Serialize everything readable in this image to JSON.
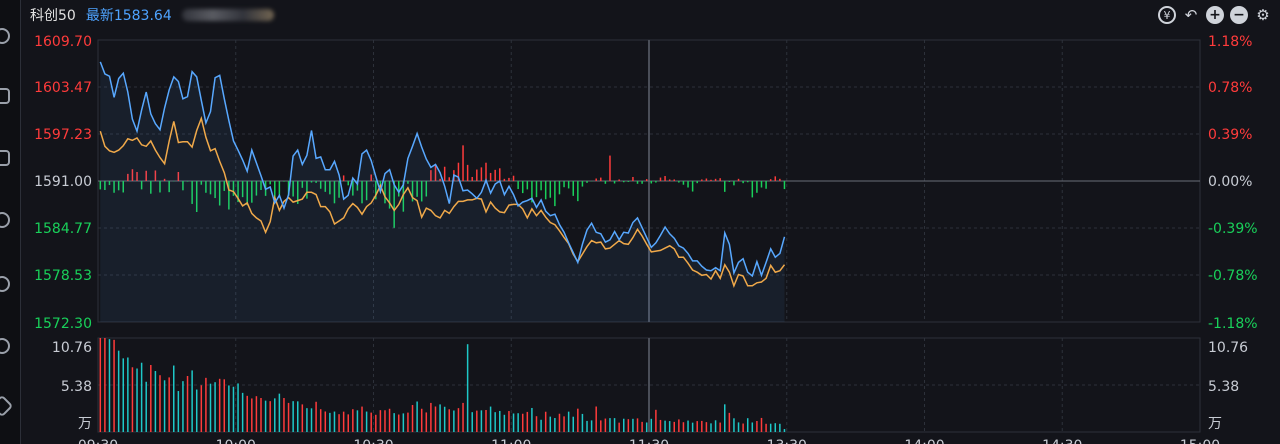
{
  "header": {
    "title": "科创50",
    "latest_label": "最新1583.64",
    "tools": [
      "reset-icon",
      "undo-icon",
      "zoom-in-icon",
      "zoom-out-icon",
      "settings-icon"
    ]
  },
  "colors": {
    "up": "#ff3b3b",
    "down": "#19d05a",
    "flat": "#c8ccd4",
    "price": "#58a8ff",
    "avg": "#f0a94a",
    "grid": "#2d313a"
  },
  "chart_data": {
    "type": "line",
    "price_axis": {
      "ylim": [
        1572.3,
        1609.7
      ],
      "ticks": [
        "1609.70",
        "1603.47",
        "1597.23",
        "1591.00",
        "1584.77",
        "1578.53",
        "1572.30"
      ],
      "base": 1591.0
    },
    "percent_axis": {
      "ticks": [
        "1.18%",
        "0.78%",
        "0.39%",
        "0.00%",
        "-0.39%",
        "-0.78%",
        "-1.18%"
      ]
    },
    "volume_axis": {
      "ylim": [
        0,
        10.76
      ],
      "ticks": [
        "10.76",
        "5.38",
        "万"
      ]
    },
    "x_ticks": [
      "09:30",
      "10:00",
      "10:30",
      "11:00",
      "11:30",
      "13:30",
      "14:00",
      "14:30",
      "15:00"
    ],
    "total_minutes": 240,
    "price": [
      1606.8,
      1605.2,
      1604.9,
      1602.1,
      1604.6,
      1605.3,
      1602.8,
      1599.2,
      1597.6,
      1600.4,
      1602.8,
      1599.9,
      1598.6,
      1597.8,
      1600.7,
      1603.1,
      1604.8,
      1604.2,
      1601.9,
      1602.2,
      1605.5,
      1604.8,
      1601.7,
      1598.7,
      1600.2,
      1604.7,
      1605.0,
      1601.9,
      1599.0,
      1596.3,
      1595.1,
      1593.8,
      1592.3,
      1595.1,
      1593.4,
      1591.7,
      1589.9,
      1590.2,
      1588.1,
      1589.1,
      1587.4,
      1589.2,
      1594.3,
      1595.1,
      1593.2,
      1594.4,
      1597.7,
      1594.0,
      1594.2,
      1592.5,
      1592.5,
      1593.6,
      1591.8,
      1588.6,
      1589.1,
      1591.4,
      1590.6,
      1594.6,
      1595.1,
      1593.7,
      1591.6,
      1589.6,
      1592.0,
      1592.5,
      1590.5,
      1589.5,
      1590.5,
      1594.0,
      1595.6,
      1597.3,
      1595.5,
      1593.9,
      1592.8,
      1593.2,
      1592.1,
      1590.3,
      1588.0,
      1591.8,
      1591.5,
      1589.7,
      1589.8,
      1589.3,
      1588.7,
      1589.5,
      1591.1,
      1589.4,
      1590.6,
      1591.0,
      1589.2,
      1590.3,
      1589.2,
      1587.7,
      1588.2,
      1588.4,
      1588.7,
      1587.5,
      1588.5,
      1587.0,
      1586.4,
      1586.6,
      1585.2,
      1584.2,
      1582.8,
      1581.5,
      1580.2,
      1582.6,
      1584.5,
      1585.4,
      1584.2,
      1584.0,
      1582.9,
      1583.2,
      1584.3,
      1583.2,
      1584.2,
      1584.1,
      1585.5,
      1586.1,
      1584.8,
      1583.5,
      1582.2,
      1582.8,
      1583.8,
      1584.9,
      1584.0,
      1583.4,
      1582.4,
      1582.1,
      1581.4,
      1580.4,
      1580.4,
      1579.7,
      1579.2,
      1579.1,
      1579.5,
      1579.1,
      1584.1,
      1582.6,
      1578.8,
      1580.2,
      1580.7,
      1578.9,
      1578.4,
      1580.3,
      1578.5,
      1580.2,
      1582.0,
      1580.9,
      1581.4,
      1583.6
    ],
    "avg": [
      1597.6,
      1595.6,
      1595.0,
      1594.8,
      1595.1,
      1595.7,
      1596.6,
      1596.4,
      1596.7,
      1595.8,
      1595.6,
      1596.3,
      1595.1,
      1594.1,
      1593.3,
      1596.3,
      1598.9,
      1596.1,
      1596.2,
      1596.2,
      1595.5,
      1597.7,
      1599.3,
      1596.8,
      1595.0,
      1595.3,
      1593.6,
      1592.1,
      1589.8,
      1589.6,
      1588.7,
      1587.7,
      1588.1,
      1586.7,
      1586.1,
      1585.7,
      1584.2,
      1585.6,
      1588.8,
      1587.1,
      1588.3,
      1588.8,
      1588.2,
      1588.4,
      1588.6,
      1589.5,
      1589.5,
      1589.2,
      1587.6,
      1587.6,
      1586.9,
      1585.3,
      1585.7,
      1586.1,
      1587.3,
      1588.0,
      1587.5,
      1586.6,
      1587.6,
      1588.1,
      1589.1,
      1590.4,
      1588.9,
      1588.1,
      1587.1,
      1587.9,
      1589.2,
      1590.1,
      1588.8,
      1588.4,
      1586.2,
      1587.4,
      1587.1,
      1586.4,
      1586.1,
      1587.1,
      1586.7,
      1587.6,
      1588.3,
      1588.3,
      1588.5,
      1588.5,
      1588.7,
      1588.6,
      1586.9,
      1588.2,
      1587.4,
      1586.9,
      1586.8,
      1587.8,
      1587.9,
      1587.9,
      1587.3,
      1586.1,
      1587.3,
      1586.4,
      1587.1,
      1586.2,
      1585.5,
      1585.2,
      1584.4,
      1583.5,
      1582.7,
      1581.3,
      1580.3,
      1581.3,
      1582.3,
      1583.1,
      1582.8,
      1582.9,
      1582.0,
      1582.1,
      1582.6,
      1583.1,
      1582.7,
      1582.6,
      1583.5,
      1584.6,
      1583.7,
      1582.6,
      1581.6,
      1581.7,
      1581.8,
      1582.1,
      1582.4,
      1582.0,
      1580.9,
      1580.9,
      1580.1,
      1579.2,
      1578.9,
      1578.5,
      1578.6,
      1578.0,
      1579.1,
      1578.1,
      1579.9,
      1578.9,
      1577.1,
      1578.6,
      1578.4,
      1577.1,
      1577.1,
      1577.5,
      1577.6,
      1578.1,
      1579.8,
      1578.9,
      1579.1,
      1579.9
    ],
    "strength": [
      -0.27,
      -0.29,
      -0.13,
      -0.38,
      -0.3,
      -0.37,
      0.23,
      0.38,
      0.29,
      -0.27,
      0.33,
      -0.41,
      0.34,
      -0.37,
      0.07,
      -0.36,
      -0.01,
      0.29,
      -0.3,
      -0.02,
      -0.74,
      -1.0,
      -0.12,
      -0.38,
      -0.43,
      -0.55,
      -0.79,
      -0.32,
      -0.92,
      -0.48,
      -0.68,
      -0.52,
      -0.78,
      -0.7,
      -0.47,
      -0.29,
      -0.48,
      -0.11,
      -0.62,
      -0.52,
      -0.02,
      -0.48,
      -0.5,
      -0.74,
      -0.22,
      -0.57,
      -0.05,
      -0.06,
      -0.25,
      -0.35,
      -0.43,
      -0.72,
      -0.54,
      0.18,
      -0.14,
      -0.47,
      -0.31,
      -0.72,
      -0.62,
      0.21,
      -0.59,
      -0.25,
      -0.72,
      -0.89,
      -1.51,
      -0.5,
      -0.99,
      -0.09,
      -0.66,
      -0.51,
      -0.66,
      -0.5,
      0.35,
      0.5,
      0.07,
      0.46,
      0.12,
      0.35,
      0.59,
      1.15,
      0.52,
      0.13,
      0.37,
      0.44,
      0.59,
      0.26,
      0.36,
      0.41,
      0.07,
      0.1,
      0.17,
      -0.26,
      -0.39,
      -0.27,
      -0.69,
      -0.52,
      -0.3,
      -0.59,
      -0.54,
      -0.81,
      -0.43,
      -0.2,
      -0.24,
      -0.48,
      -0.65,
      -0.18,
      -0.06,
      -0.01,
      0.08,
      0.11,
      -0.09,
      0.82,
      -0.08,
      0.05,
      -0.04,
      -0.03,
      0.13,
      -0.09,
      -0.09,
      0.06,
      -0.08,
      -0.05,
      0.11,
      0.16,
      0.05,
      0.05,
      -0.05,
      -0.12,
      -0.21,
      -0.34,
      -0.07,
      0.05,
      0.08,
      0.04,
      0.07,
      0.09,
      -0.35,
      -0.03,
      -0.14,
      0.07,
      -0.07,
      -0.04,
      -0.53,
      -0.38,
      -0.21,
      -0.25,
      0.06,
      0.15,
      0.07,
      -0.26
    ],
    "volume": [
      13.45,
      12.93,
      10.63,
      10.55,
      9.31,
      8.43,
      8.53,
      7.41,
      7.27,
      7.93,
      5.75,
      7.67,
      6.98,
      6.5,
      5.92,
      6.25,
      7.61,
      4.69,
      5.82,
      6.41,
      7.05,
      4.86,
      5.35,
      6.2,
      5.53,
      5.7,
      6.09,
      6.03,
      5.33,
      5.18,
      5.56,
      4.48,
      4.14,
      3.84,
      4.1,
      3.89,
      3.59,
      3.53,
      3.85,
      4.39,
      3.89,
      3.33,
      3.53,
      3.51,
      3.16,
      2.73,
      2.71,
      3.46,
      2.61,
      2.35,
      2.19,
      2.34,
      2.04,
      2.33,
      2.02,
      2.61,
      2.48,
      2.91,
      2.34,
      2.22,
      1.97,
      2.5,
      2.49,
      2.66,
      2.16,
      2.0,
      2.13,
      2.22,
      3.09,
      3.49,
      2.66,
      2.24,
      3.33,
      2.92,
      3.16,
      2.89,
      2.6,
      2.46,
      2.73,
      3.33,
      10.05,
      2.27,
      2.45,
      2.48,
      2.52,
      2.91,
      2.27,
      2.41,
      1.97,
      2.4,
      2.12,
      2.15,
      2.09,
      2.3,
      2.75,
      1.81,
      1.4,
      2.32,
      1.76,
      1.6,
      2.09,
      1.79,
      2.33,
      1.75,
      2.67,
      2.07,
      1.27,
      1.33,
      2.92,
      1.33,
      1.54,
      1.59,
      1.59,
      1.07,
      1.52,
      1.47,
      1.51,
      1.56,
      1.16,
      1.09,
      1.51,
      2.54,
      1.38,
      1.3,
      1.25,
      1.16,
      1.44,
      1.12,
      1.31,
      1.07,
      1.25,
      1.27,
      1.13,
      0.99,
      1.34,
      1.08,
      3.17,
      2.19,
      1.57,
      1.1,
      0.97,
      1.58,
      1.09,
      1.26,
      1.61,
      0.94,
      0.95,
      1.01,
      0.94,
      0.34
    ],
    "volume_up": [
      true,
      true,
      false,
      true,
      false,
      false,
      false,
      true,
      false,
      false,
      false,
      true,
      false,
      true,
      false,
      true,
      false,
      false,
      false,
      true,
      false,
      false,
      true,
      true,
      false,
      false,
      true,
      true,
      false,
      false,
      false,
      false,
      true,
      true,
      true,
      true,
      false,
      true,
      false,
      false,
      true,
      true,
      false,
      false,
      true,
      false,
      false,
      true,
      true,
      true,
      false,
      false,
      true,
      true,
      true,
      true,
      false,
      true,
      false,
      true,
      true,
      true,
      true,
      true,
      false,
      true,
      false,
      true,
      true,
      false,
      true,
      true,
      true,
      true,
      false,
      false,
      true,
      false,
      true,
      true,
      false,
      false,
      true,
      false,
      true,
      false,
      false,
      false,
      false,
      true,
      false,
      false,
      true,
      true,
      false,
      true,
      false,
      true,
      false,
      false,
      true,
      true,
      false,
      false,
      true,
      false,
      false,
      false,
      true,
      true,
      true,
      false,
      false,
      true,
      false,
      true,
      false,
      true,
      true,
      false,
      false,
      true,
      true,
      false,
      false,
      true,
      true,
      true,
      false,
      false,
      true,
      true,
      true,
      false,
      false,
      true,
      false,
      true,
      false,
      false,
      true,
      false,
      false,
      true,
      true,
      true,
      false,
      false,
      false,
      false
    ]
  }
}
